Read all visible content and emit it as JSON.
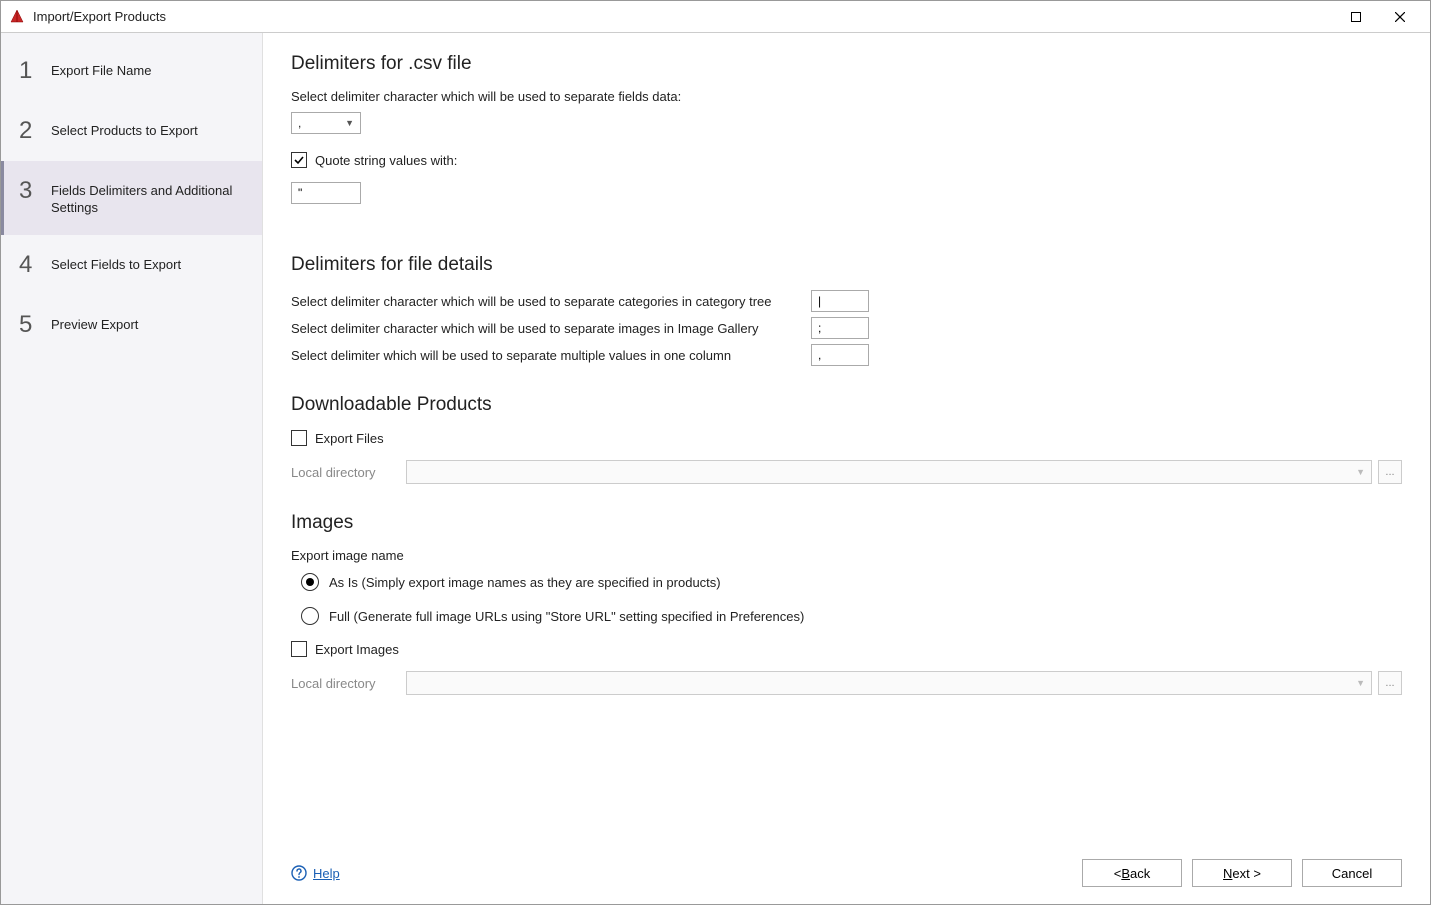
{
  "window": {
    "title": "Import/Export Products"
  },
  "sidebar": {
    "steps": [
      {
        "num": "1",
        "label": "Export File Name"
      },
      {
        "num": "2",
        "label": "Select Products to Export"
      },
      {
        "num": "3",
        "label": "Fields Delimiters and Additional Settings"
      },
      {
        "num": "4",
        "label": "Select Fields to Export"
      },
      {
        "num": "5",
        "label": "Preview Export"
      }
    ]
  },
  "csv": {
    "heading": "Delimiters for .csv file",
    "select_label": "Select delimiter character which will be used to separate fields data:",
    "delimiter_value": ",",
    "quote_checkbox_label": "Quote string values with:",
    "quote_value": "\""
  },
  "details": {
    "heading": "Delimiters for file details",
    "cat_label": "Select delimiter character which will be used to separate categories in category tree",
    "cat_value": "|",
    "img_label": "Select delimiter character which will be used to separate images in Image Gallery",
    "img_value": ";",
    "multi_label": "Select delimiter which will be used to separate multiple values in one column",
    "multi_value": ","
  },
  "downloadable": {
    "heading": "Downloadable Products",
    "export_files_label": "Export Files",
    "local_dir_label": "Local directory",
    "browse_text": "..."
  },
  "images": {
    "heading": "Images",
    "export_name_label": "Export image name",
    "radio_asis": "As Is (Simply export image names as they are specified in products)",
    "radio_full": "Full (Generate full image URLs using \"Store URL\" setting specified in Preferences)",
    "export_images_label": "Export Images",
    "local_dir_label": "Local directory",
    "browse_text": "..."
  },
  "footer": {
    "help": "Help",
    "back_prefix": "< ",
    "back_accel": "B",
    "back_suffix": "ack",
    "next_accel": "N",
    "next_suffix": "ext >",
    "cancel": "Cancel"
  }
}
